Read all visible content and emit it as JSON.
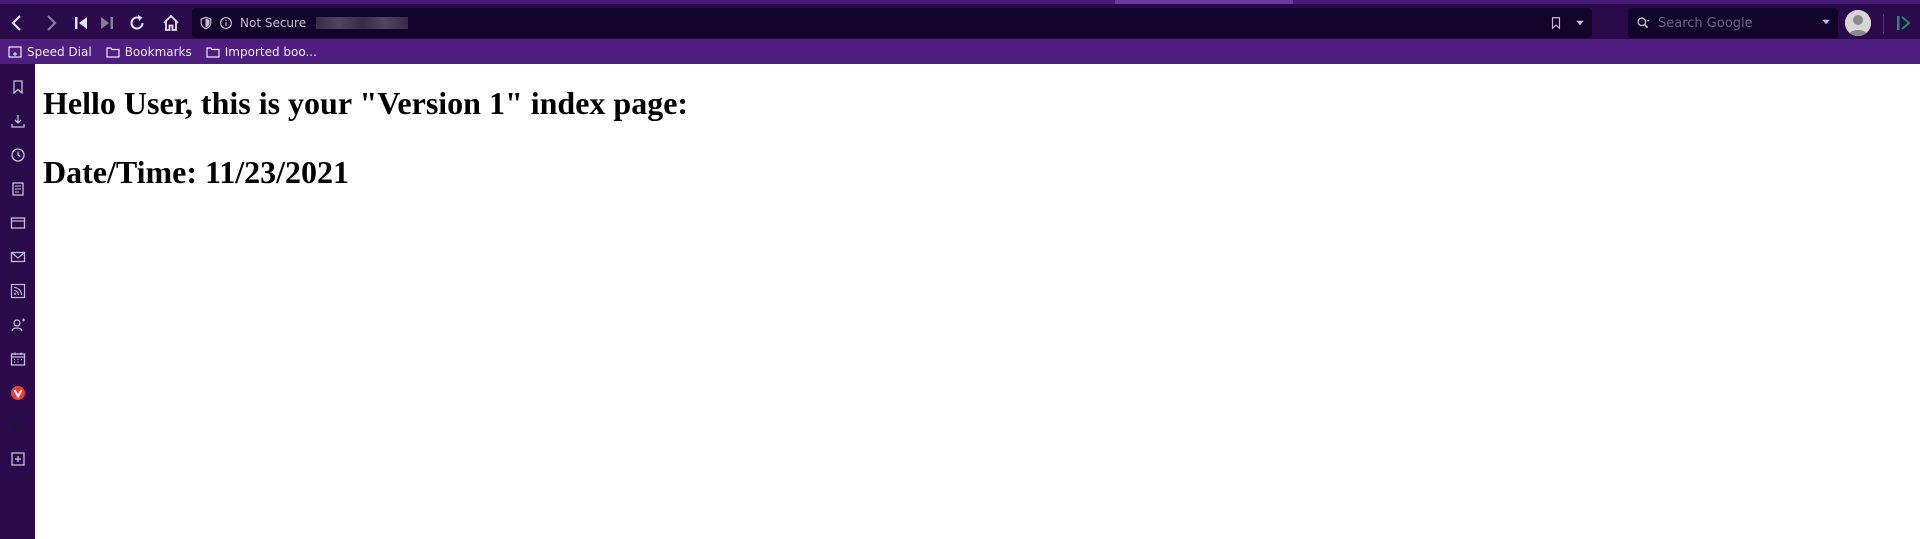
{
  "toolbar": {
    "not_secure_label": "Not Secure",
    "search_placeholder": "Search Google"
  },
  "bookmarks_bar": {
    "items": [
      {
        "label": "Speed Dial",
        "icon": "speed-dial-icon"
      },
      {
        "label": "Bookmarks",
        "icon": "folder-icon"
      },
      {
        "label": "Imported boo...",
        "icon": "folder-icon"
      }
    ]
  },
  "sidebar": {
    "icons": [
      "bookmark-icon",
      "download-icon",
      "history-icon",
      "notes-icon",
      "window-icon",
      "mail-icon",
      "feed-icon",
      "contacts-icon",
      "calendar-icon",
      "vivaldi-icon",
      "wikipedia-icon",
      "add-panel-icon"
    ]
  },
  "page": {
    "heading_hello": "Hello User, this is your \"Version 1\" index page:",
    "heading_date": "Date/Time: 11/23/2021"
  },
  "colors": {
    "toolbar_bg": "#2a0a4a",
    "bookmarks_bg": "#4e1e7e",
    "address_bg": "#12032a",
    "page_bg": "#ffffff"
  }
}
